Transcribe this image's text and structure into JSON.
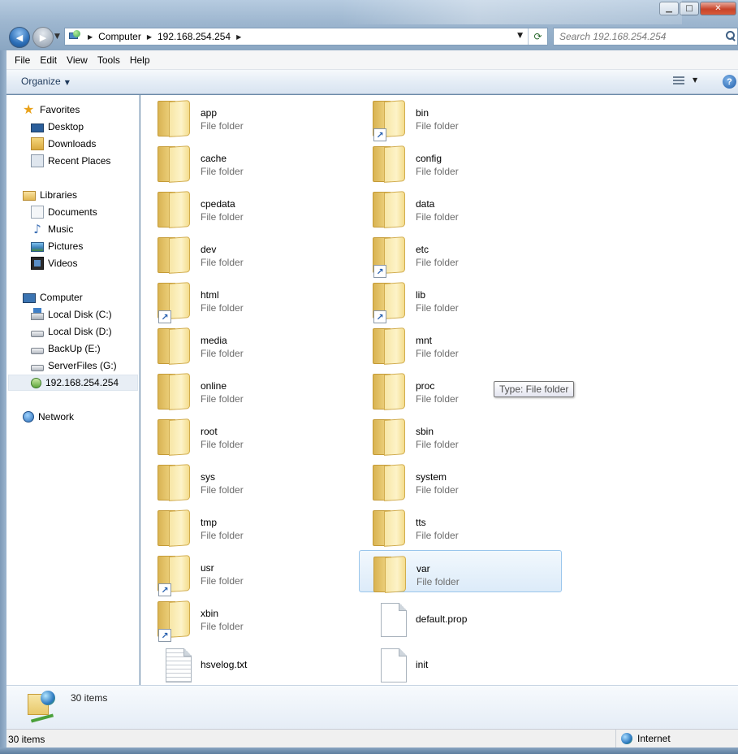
{
  "window": {
    "controls": {
      "minimize": "▁",
      "maximize": "□",
      "close": "✕"
    }
  },
  "navigation": {
    "back_icon": "◀",
    "forward_icon": "▶",
    "dropdown_icon": "▼"
  },
  "address": {
    "crumbs": [
      "Computer",
      "192.168.254.254"
    ],
    "separator": "▶",
    "dropdown_icon": "▼",
    "refresh_icon": "⟳"
  },
  "search": {
    "placeholder": "Search 192.168.254.254"
  },
  "menu": {
    "items": [
      "File",
      "Edit",
      "View",
      "Tools",
      "Help"
    ]
  },
  "toolbar": {
    "organize_label": "Organize",
    "dropdown_icon": "▼",
    "help_label": "?"
  },
  "sidebar": {
    "favorites": {
      "label": "Favorites",
      "items": [
        "Desktop",
        "Downloads",
        "Recent Places"
      ]
    },
    "libraries": {
      "label": "Libraries",
      "items": [
        "Documents",
        "Music",
        "Pictures",
        "Videos"
      ]
    },
    "computer": {
      "label": "Computer",
      "items": [
        "Local Disk (C:)",
        "Local Disk (D:)",
        "BackUp (E:)",
        "ServerFiles (G:)",
        "192.168.254.254"
      ],
      "selected": "192.168.254.254"
    },
    "network": {
      "label": "Network"
    }
  },
  "files": [
    {
      "name": "app",
      "type": "File folder",
      "kind": "folder",
      "shortcut": false
    },
    {
      "name": "bin",
      "type": "File folder",
      "kind": "folder",
      "shortcut": true
    },
    {
      "name": "cache",
      "type": "File folder",
      "kind": "folder",
      "shortcut": false
    },
    {
      "name": "config",
      "type": "File folder",
      "kind": "folder",
      "shortcut": false
    },
    {
      "name": "cpedata",
      "type": "File folder",
      "kind": "folder",
      "shortcut": false
    },
    {
      "name": "data",
      "type": "File folder",
      "kind": "folder",
      "shortcut": false
    },
    {
      "name": "dev",
      "type": "File folder",
      "kind": "folder",
      "shortcut": false
    },
    {
      "name": "etc",
      "type": "File folder",
      "kind": "folder",
      "shortcut": true
    },
    {
      "name": "html",
      "type": "File folder",
      "kind": "folder",
      "shortcut": true
    },
    {
      "name": "lib",
      "type": "File folder",
      "kind": "folder",
      "shortcut": true
    },
    {
      "name": "media",
      "type": "File folder",
      "kind": "folder",
      "shortcut": false
    },
    {
      "name": "mnt",
      "type": "File folder",
      "kind": "folder",
      "shortcut": false
    },
    {
      "name": "online",
      "type": "File folder",
      "kind": "folder",
      "shortcut": false
    },
    {
      "name": "proc",
      "type": "File folder",
      "kind": "folder",
      "shortcut": false
    },
    {
      "name": "root",
      "type": "File folder",
      "kind": "folder",
      "shortcut": false
    },
    {
      "name": "sbin",
      "type": "File folder",
      "kind": "folder",
      "shortcut": false
    },
    {
      "name": "sys",
      "type": "File folder",
      "kind": "folder",
      "shortcut": false
    },
    {
      "name": "system",
      "type": "File folder",
      "kind": "folder",
      "shortcut": false
    },
    {
      "name": "tmp",
      "type": "File folder",
      "kind": "folder",
      "shortcut": false
    },
    {
      "name": "tts",
      "type": "File folder",
      "kind": "folder",
      "shortcut": false
    },
    {
      "name": "usr",
      "type": "File folder",
      "kind": "folder",
      "shortcut": true
    },
    {
      "name": "var",
      "type": "File folder",
      "kind": "folder",
      "shortcut": false,
      "selected": true
    },
    {
      "name": "xbin",
      "type": "File folder",
      "kind": "folder",
      "shortcut": true
    },
    {
      "name": "default.prop",
      "type": "",
      "kind": "file",
      "shortcut": false
    },
    {
      "name": "hsvelog.txt",
      "type": "",
      "kind": "text",
      "shortcut": false
    },
    {
      "name": "init",
      "type": "",
      "kind": "file",
      "shortcut": false
    }
  ],
  "tooltip": {
    "text": "Type: File folder"
  },
  "details": {
    "count": "30 items"
  },
  "status": {
    "count": "30 items",
    "zone": "Internet"
  }
}
